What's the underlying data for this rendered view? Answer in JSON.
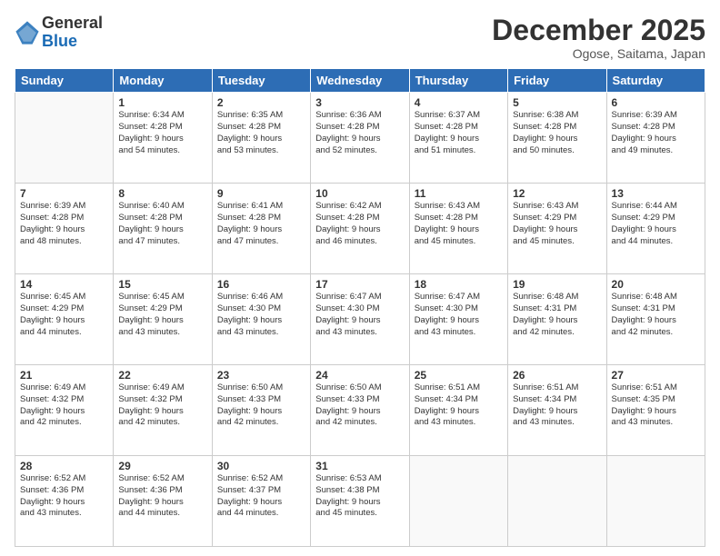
{
  "logo": {
    "general": "General",
    "blue": "Blue"
  },
  "title": "December 2025",
  "location": "Ogose, Saitama, Japan",
  "days_header": [
    "Sunday",
    "Monday",
    "Tuesday",
    "Wednesday",
    "Thursday",
    "Friday",
    "Saturday"
  ],
  "weeks": [
    [
      {
        "day": "",
        "info": ""
      },
      {
        "day": "1",
        "info": "Sunrise: 6:34 AM\nSunset: 4:28 PM\nDaylight: 9 hours\nand 54 minutes."
      },
      {
        "day": "2",
        "info": "Sunrise: 6:35 AM\nSunset: 4:28 PM\nDaylight: 9 hours\nand 53 minutes."
      },
      {
        "day": "3",
        "info": "Sunrise: 6:36 AM\nSunset: 4:28 PM\nDaylight: 9 hours\nand 52 minutes."
      },
      {
        "day": "4",
        "info": "Sunrise: 6:37 AM\nSunset: 4:28 PM\nDaylight: 9 hours\nand 51 minutes."
      },
      {
        "day": "5",
        "info": "Sunrise: 6:38 AM\nSunset: 4:28 PM\nDaylight: 9 hours\nand 50 minutes."
      },
      {
        "day": "6",
        "info": "Sunrise: 6:39 AM\nSunset: 4:28 PM\nDaylight: 9 hours\nand 49 minutes."
      }
    ],
    [
      {
        "day": "7",
        "info": "Sunrise: 6:39 AM\nSunset: 4:28 PM\nDaylight: 9 hours\nand 48 minutes."
      },
      {
        "day": "8",
        "info": "Sunrise: 6:40 AM\nSunset: 4:28 PM\nDaylight: 9 hours\nand 47 minutes."
      },
      {
        "day": "9",
        "info": "Sunrise: 6:41 AM\nSunset: 4:28 PM\nDaylight: 9 hours\nand 47 minutes."
      },
      {
        "day": "10",
        "info": "Sunrise: 6:42 AM\nSunset: 4:28 PM\nDaylight: 9 hours\nand 46 minutes."
      },
      {
        "day": "11",
        "info": "Sunrise: 6:43 AM\nSunset: 4:28 PM\nDaylight: 9 hours\nand 45 minutes."
      },
      {
        "day": "12",
        "info": "Sunrise: 6:43 AM\nSunset: 4:29 PM\nDaylight: 9 hours\nand 45 minutes."
      },
      {
        "day": "13",
        "info": "Sunrise: 6:44 AM\nSunset: 4:29 PM\nDaylight: 9 hours\nand 44 minutes."
      }
    ],
    [
      {
        "day": "14",
        "info": "Sunrise: 6:45 AM\nSunset: 4:29 PM\nDaylight: 9 hours\nand 44 minutes."
      },
      {
        "day": "15",
        "info": "Sunrise: 6:45 AM\nSunset: 4:29 PM\nDaylight: 9 hours\nand 43 minutes."
      },
      {
        "day": "16",
        "info": "Sunrise: 6:46 AM\nSunset: 4:30 PM\nDaylight: 9 hours\nand 43 minutes."
      },
      {
        "day": "17",
        "info": "Sunrise: 6:47 AM\nSunset: 4:30 PM\nDaylight: 9 hours\nand 43 minutes."
      },
      {
        "day": "18",
        "info": "Sunrise: 6:47 AM\nSunset: 4:30 PM\nDaylight: 9 hours\nand 43 minutes."
      },
      {
        "day": "19",
        "info": "Sunrise: 6:48 AM\nSunset: 4:31 PM\nDaylight: 9 hours\nand 42 minutes."
      },
      {
        "day": "20",
        "info": "Sunrise: 6:48 AM\nSunset: 4:31 PM\nDaylight: 9 hours\nand 42 minutes."
      }
    ],
    [
      {
        "day": "21",
        "info": "Sunrise: 6:49 AM\nSunset: 4:32 PM\nDaylight: 9 hours\nand 42 minutes."
      },
      {
        "day": "22",
        "info": "Sunrise: 6:49 AM\nSunset: 4:32 PM\nDaylight: 9 hours\nand 42 minutes."
      },
      {
        "day": "23",
        "info": "Sunrise: 6:50 AM\nSunset: 4:33 PM\nDaylight: 9 hours\nand 42 minutes."
      },
      {
        "day": "24",
        "info": "Sunrise: 6:50 AM\nSunset: 4:33 PM\nDaylight: 9 hours\nand 42 minutes."
      },
      {
        "day": "25",
        "info": "Sunrise: 6:51 AM\nSunset: 4:34 PM\nDaylight: 9 hours\nand 43 minutes."
      },
      {
        "day": "26",
        "info": "Sunrise: 6:51 AM\nSunset: 4:34 PM\nDaylight: 9 hours\nand 43 minutes."
      },
      {
        "day": "27",
        "info": "Sunrise: 6:51 AM\nSunset: 4:35 PM\nDaylight: 9 hours\nand 43 minutes."
      }
    ],
    [
      {
        "day": "28",
        "info": "Sunrise: 6:52 AM\nSunset: 4:36 PM\nDaylight: 9 hours\nand 43 minutes."
      },
      {
        "day": "29",
        "info": "Sunrise: 6:52 AM\nSunset: 4:36 PM\nDaylight: 9 hours\nand 44 minutes."
      },
      {
        "day": "30",
        "info": "Sunrise: 6:52 AM\nSunset: 4:37 PM\nDaylight: 9 hours\nand 44 minutes."
      },
      {
        "day": "31",
        "info": "Sunrise: 6:53 AM\nSunset: 4:38 PM\nDaylight: 9 hours\nand 45 minutes."
      },
      {
        "day": "",
        "info": ""
      },
      {
        "day": "",
        "info": ""
      },
      {
        "day": "",
        "info": ""
      }
    ]
  ]
}
